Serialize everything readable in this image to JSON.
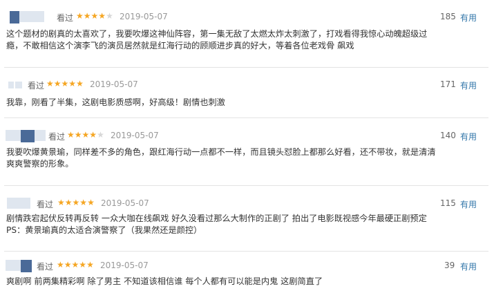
{
  "watched_label": "看过",
  "useful_label": "有用",
  "reviews": [
    {
      "rating": 4,
      "date": "2019-05-07",
      "votes": "185",
      "lines": [
        "这个题材的剧真的太喜欢了，我要吹爆这神仙阵容，第一集无敌了太燃太炸太刺激了，打戏看得我惊心动魄超级过",
        "瘾，不敢相信这个演李飞的演员居然就是红海行动的顾顺进步真的好大，等着各位老戏骨 飙戏"
      ]
    },
    {
      "rating": 5,
      "date": "2019-05-07",
      "votes": "171",
      "lines": [
        "我靠，刚看了半集，这剧电影质感啊，好高级！剧情也刺激"
      ]
    },
    {
      "rating": 4,
      "date": "2019-05-07",
      "votes": "140",
      "lines": [
        "我要吹爆黄景瑜，同样差不多的角色，跟红海行动一点都不一样，而且镜头怼脸上都那么好看，还不带妆，就是清清",
        "爽爽警察的形象。"
      ]
    },
    {
      "rating": 5,
      "date": "2019-05-07",
      "votes": "115",
      "lines": [
        "剧情跌宕起伏反转再反转 一众大咖在线飙戏 好久没看过那么大制作的正剧了 拍出了电影既视感今年最硬正剧预定",
        "PS：黄景瑜真的太适合演警察了（我果然还是颜控）"
      ]
    },
    {
      "rating": 5,
      "date": "2019-05-07",
      "votes": "39",
      "lines": [
        "爽剧啊 前两集精彩啊 除了男主 不知道该相信谁 每个人都有可以能是内鬼 这剧简直了"
      ]
    }
  ],
  "colors": {
    "star_on": "#f5a623",
    "star_off": "#d7d7d7",
    "useful_link": "#3377aa",
    "avatar": "#4a6a98"
  }
}
